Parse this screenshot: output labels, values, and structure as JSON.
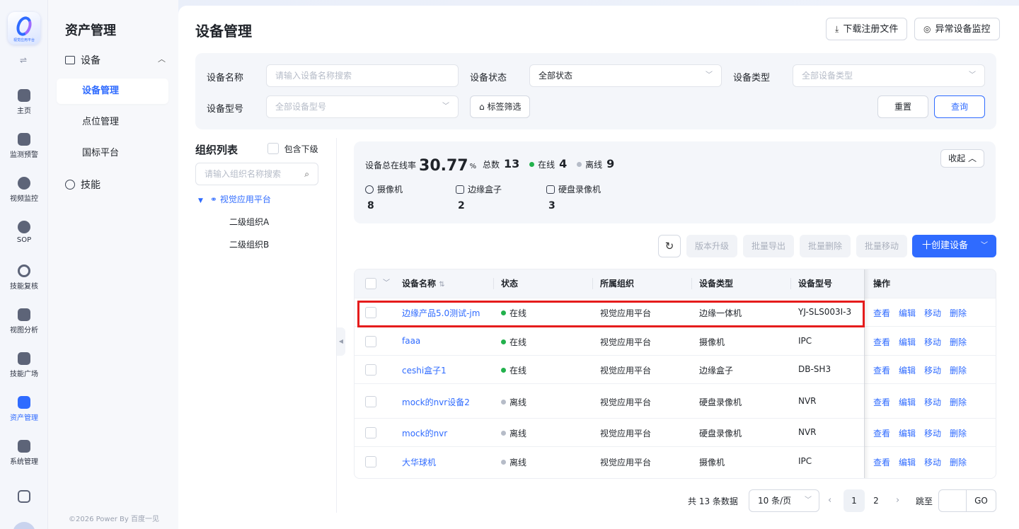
{
  "app": {
    "logo_text": "视觉应用平台"
  },
  "rail": [
    {
      "label": "主页",
      "icon": "home-icon"
    },
    {
      "label": "监测预警",
      "icon": "chart-icon"
    },
    {
      "label": "视频监控",
      "icon": "camera-icon"
    },
    {
      "label": "SOP",
      "icon": "sop-icon"
    },
    {
      "label": "技能复核",
      "icon": "review-icon"
    },
    {
      "label": "视图分析",
      "icon": "analysis-icon"
    },
    {
      "label": "技能广场",
      "icon": "skills-icon"
    },
    {
      "label": "资产管理",
      "icon": "asset-icon",
      "active": true
    },
    {
      "label": "系统管理",
      "icon": "system-icon"
    }
  ],
  "subnav": {
    "title": "资产管理",
    "group_device": "设备",
    "items": [
      "设备管理",
      "点位管理",
      "国标平台"
    ],
    "group_skill": "技能",
    "copyright": "©2026 Power By 百度一见"
  },
  "page": {
    "title": "设备管理",
    "download_label": "下载注册文件",
    "monitor_label": "异常设备监控"
  },
  "filter": {
    "name_label": "设备名称",
    "name_placeholder": "请输入设备名称搜索",
    "status_label": "设备状态",
    "status_value": "全部状态",
    "type_label": "设备类型",
    "type_placeholder": "全部设备类型",
    "model_label": "设备型号",
    "model_placeholder": "全部设备型号",
    "tag_label": "标签筛选",
    "reset_label": "重置",
    "query_label": "查询"
  },
  "org": {
    "title": "组织列表",
    "include_sub": "包含下级",
    "search_placeholder": "请输入组织名称搜索",
    "root": "视觉应用平台",
    "children": [
      "二级组织A",
      "二级组织B"
    ]
  },
  "stats": {
    "online_rate_label": "设备总在线率",
    "online_rate": "30.77",
    "online_rate_unit": "%",
    "total_label": "总数",
    "total": "13",
    "online_label": "在线",
    "online": "4",
    "offline_label": "离线",
    "offline": "9",
    "collapse_label": "收起",
    "types": [
      {
        "label": "摄像机",
        "count": "8"
      },
      {
        "label": "边缘盒子",
        "count": "2"
      },
      {
        "label": "硬盘录像机",
        "count": "3"
      }
    ]
  },
  "toolbar": {
    "upgrade": "版本升级",
    "export": "批量导出",
    "delete": "批量删除",
    "move": "批量移动",
    "create": "十创建设备"
  },
  "table": {
    "columns": [
      "设备名称",
      "状态",
      "所属组织",
      "设备类型",
      "设备型号",
      "操作"
    ],
    "actions": [
      "查看",
      "编辑",
      "移动",
      "删除"
    ],
    "rows": [
      {
        "name": "边缘产品5.0测试-jm",
        "status": "在线",
        "online": true,
        "org": "视觉应用平台",
        "type": "边缘一体机",
        "model": "YJ-SLS003I-3"
      },
      {
        "name": "faaa",
        "status": "在线",
        "online": true,
        "org": "视觉应用平台",
        "type": "摄像机",
        "model": "IPC"
      },
      {
        "name": "ceshi盒子1",
        "status": "在线",
        "online": true,
        "org": "视觉应用平台",
        "type": "边缘盒子",
        "model": "DB-SH3"
      },
      {
        "name": "mock的nvr设备2",
        "status": "离线",
        "online": false,
        "org": "视觉应用平台",
        "type": "硬盘录像机",
        "model": "NVR"
      },
      {
        "name": "mock的nvr",
        "status": "离线",
        "online": false,
        "org": "视觉应用平台",
        "type": "硬盘录像机",
        "model": "NVR"
      },
      {
        "name": "大华球机",
        "status": "离线",
        "online": false,
        "org": "视觉应用平台",
        "type": "摄像机",
        "model": "IPC"
      }
    ]
  },
  "pagination": {
    "total_text": "共 13 条数据",
    "page_size": "10 条/页",
    "pages": [
      "1",
      "2"
    ],
    "jump_label": "跳至",
    "go_label": "GO"
  },
  "colors": {
    "primary": "#2f6bff",
    "online": "#22b14c",
    "offline": "#b6bcc8",
    "highlight": "#e51c1c"
  }
}
